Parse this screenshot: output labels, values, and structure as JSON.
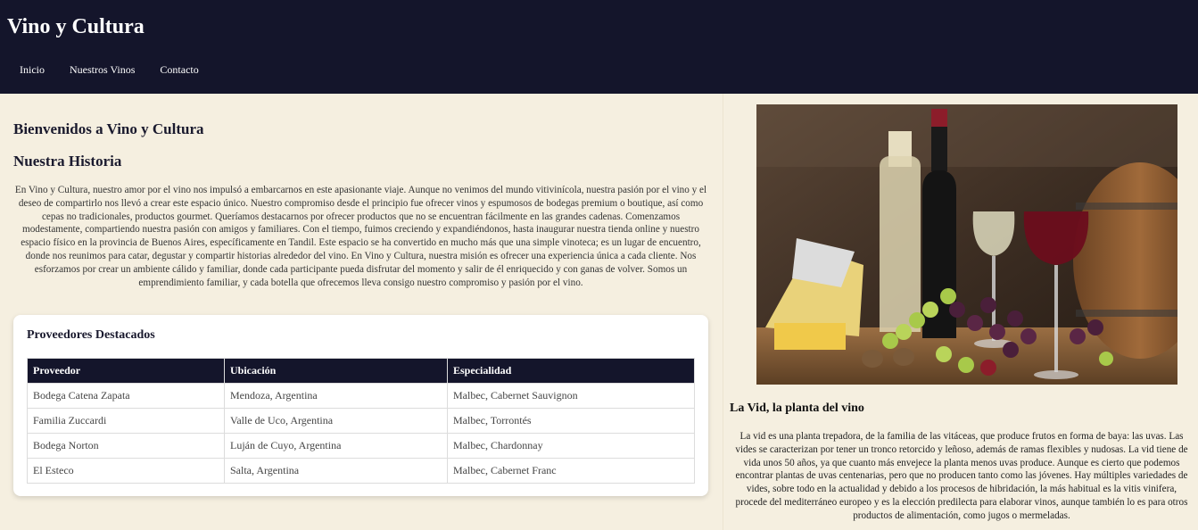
{
  "site": {
    "title": "Vino y Cultura"
  },
  "nav": {
    "items": [
      {
        "label": "Inicio"
      },
      {
        "label": "Nuestros Vinos"
      },
      {
        "label": "Contacto"
      }
    ]
  },
  "main": {
    "welcome": "Bienvenidos a Vino y Cultura",
    "history_title": "Nuestra Historia",
    "history_text": "En Vino y Cultura, nuestro amor por el vino nos impulsó a embarcarnos en este apasionante viaje. Aunque no venimos del mundo vitivinícola, nuestra pasión por el vino y el deseo de compartirlo nos llevó a crear este espacio único. Nuestro compromiso desde el principio fue ofrecer vinos y espumosos de bodegas premium o boutique, así como cepas no tradicionales, productos gourmet. Queríamos destacarnos por ofrecer productos que no se encuentran fácilmente en las grandes cadenas. Comenzamos modestamente, compartiendo nuestra pasión con amigos y familiares. Con el tiempo, fuimos creciendo y expandiéndonos, hasta inaugurar nuestra tienda online y nuestro espacio físico en la provincia de Buenos Aires, específicamente en Tandil. Este espacio se ha convertido en mucho más que una simple vinoteca; es un lugar de encuentro, donde nos reunimos para catar, degustar y compartir historias alrededor del vino. En Vino y Cultura, nuestra misión es ofrecer una experiencia única a cada cliente. Nos esforzamos por crear un ambiente cálido y familiar, donde cada participante pueda disfrutar del momento y salir de él enriquecido y con ganas de volver. Somos un emprendimiento familiar, y cada botella que ofrecemos lleva consigo nuestro compromiso y pasión por el vino."
  },
  "providers": {
    "title": "Proveedores Destacados",
    "headers": [
      "Proveedor",
      "Ubicación",
      "Especialidad"
    ],
    "rows": [
      [
        "Bodega Catena Zapata",
        "Mendoza, Argentina",
        "Malbec, Cabernet Sauvignon"
      ],
      [
        "Familia Zuccardi",
        "Valle de Uco, Argentina",
        "Malbec, Torrontés"
      ],
      [
        "Bodega Norton",
        "Luján de Cuyo, Argentina",
        "Malbec, Chardonnay"
      ],
      [
        "El Esteco",
        "Salta, Argentina",
        "Malbec, Cabernet Franc"
      ]
    ]
  },
  "aside": {
    "vid_title": "La Vid, la planta del vino",
    "vid_text": "La vid es una planta trepadora, de la familia de las vitáceas, que produce frutos en forma de baya: las uvas. Las vides se caracterizan por tener un tronco retorcido y leñoso, además de ramas flexibles y nudosas. La vid tiene de vida unos 50 años, ya que cuanto más envejece la planta menos uvas produce. Aunque es cierto que podemos encontrar plantas de uvas centenarias, pero que no producen tanto como las jóvenes. Hay múltiples variedades de vides, sobre todo en la actualidad y debido a los procesos de hibridación, la más habitual es la vitis vinifera, procede del mediterráneo europeo y es la elección predilecta para elaborar vinos, aunque también lo es para otros productos de alimentación, como jugos o mermeladas."
  },
  "colors": {
    "header_bg": "#14152b",
    "page_bg": "#f5efe0",
    "card_bg": "#ffffff",
    "table_header_bg": "#14152b"
  }
}
